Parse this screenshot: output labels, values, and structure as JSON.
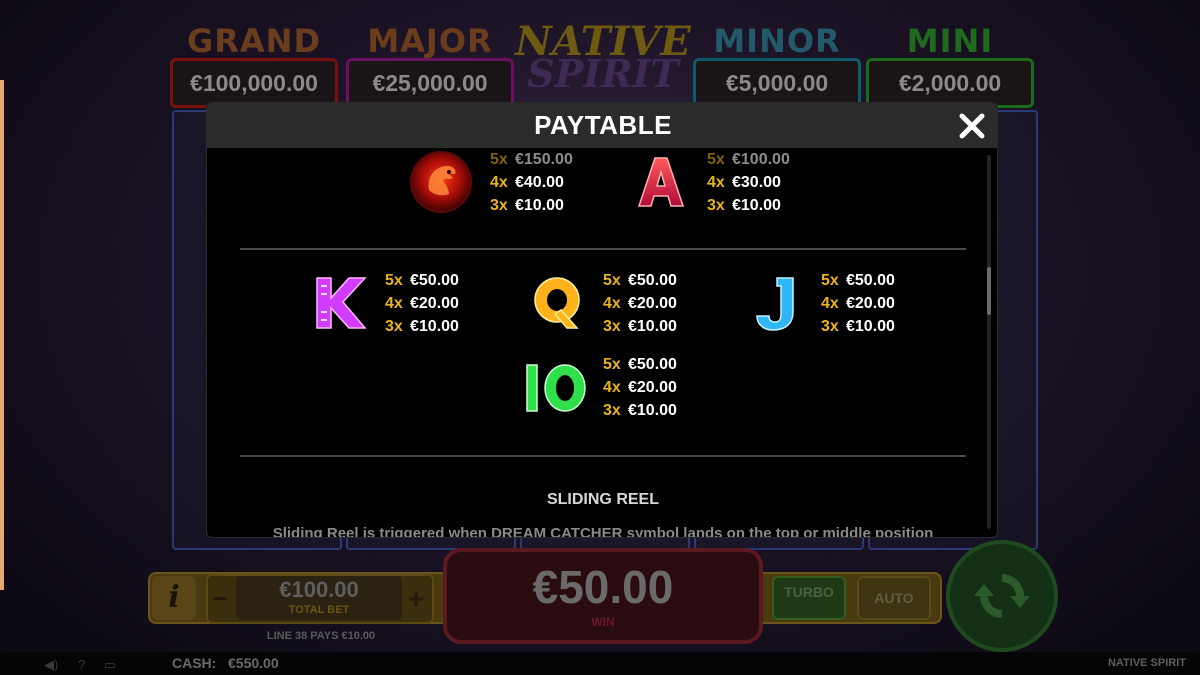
{
  "game": {
    "name": "NATIVE SPIRIT",
    "logo_line1": "NATIVE",
    "logo_line2": "SPIRIT"
  },
  "jackpots": [
    {
      "title": "GRAND",
      "amount": "€100,000.00"
    },
    {
      "title": "MAJOR",
      "amount": "€25,000.00"
    },
    {
      "title": "MINOR",
      "amount": "€5,000.00"
    },
    {
      "title": "MINI",
      "amount": "€2,000.00"
    }
  ],
  "controls": {
    "info_label": "i",
    "bet_minus": "−",
    "bet_plus": "+",
    "total_bet_value": "€100.00",
    "total_bet_label": "TOTAL BET",
    "line_pays": "LINE 38 PAYS €10.00",
    "win_value": "€50.00",
    "win_label": "WIN",
    "turbo_label": "TURBO",
    "auto_label": "AUTO"
  },
  "status": {
    "cash_label": "CASH:",
    "cash_value": "€550.00"
  },
  "paytable": {
    "title": "PAYTABLE",
    "high_symbols": [
      {
        "icon": "eagle-symbol",
        "pays": [
          {
            "count": "5x",
            "amount": "€150.00"
          },
          {
            "count": "4x",
            "amount": "€40.00"
          },
          {
            "count": "3x",
            "amount": "€10.00"
          }
        ]
      },
      {
        "icon": "letter-a-symbol",
        "glyph": "A",
        "pays": [
          {
            "count": "5x",
            "amount": "€100.00"
          },
          {
            "count": "4x",
            "amount": "€30.00"
          },
          {
            "count": "3x",
            "amount": "€10.00"
          }
        ]
      }
    ],
    "low_symbols": [
      {
        "icon": "letter-k-symbol",
        "glyph": "K",
        "color": "#d23cff",
        "pays": [
          {
            "count": "5x",
            "amount": "€50.00"
          },
          {
            "count": "4x",
            "amount": "€20.00"
          },
          {
            "count": "3x",
            "amount": "€10.00"
          }
        ]
      },
      {
        "icon": "letter-q-symbol",
        "glyph": "Q",
        "color": "#ffb21a",
        "pays": [
          {
            "count": "5x",
            "amount": "€50.00"
          },
          {
            "count": "4x",
            "amount": "€20.00"
          },
          {
            "count": "3x",
            "amount": "€10.00"
          }
        ]
      },
      {
        "icon": "letter-j-symbol",
        "glyph": "J",
        "color": "#2fb6f5",
        "pays": [
          {
            "count": "5x",
            "amount": "€50.00"
          },
          {
            "count": "4x",
            "amount": "€20.00"
          },
          {
            "count": "3x",
            "amount": "€10.00"
          }
        ]
      },
      {
        "icon": "ten-symbol",
        "glyph": "IO",
        "color": "#2fe04a",
        "pays": [
          {
            "count": "5x",
            "amount": "€50.00"
          },
          {
            "count": "4x",
            "amount": "€20.00"
          },
          {
            "count": "3x",
            "amount": "€10.00"
          }
        ]
      }
    ],
    "section_title": "SLIDING REEL",
    "section_text": "Sliding Reel is triggered when DREAM CATCHER symbol lands on the top or middle position"
  }
}
